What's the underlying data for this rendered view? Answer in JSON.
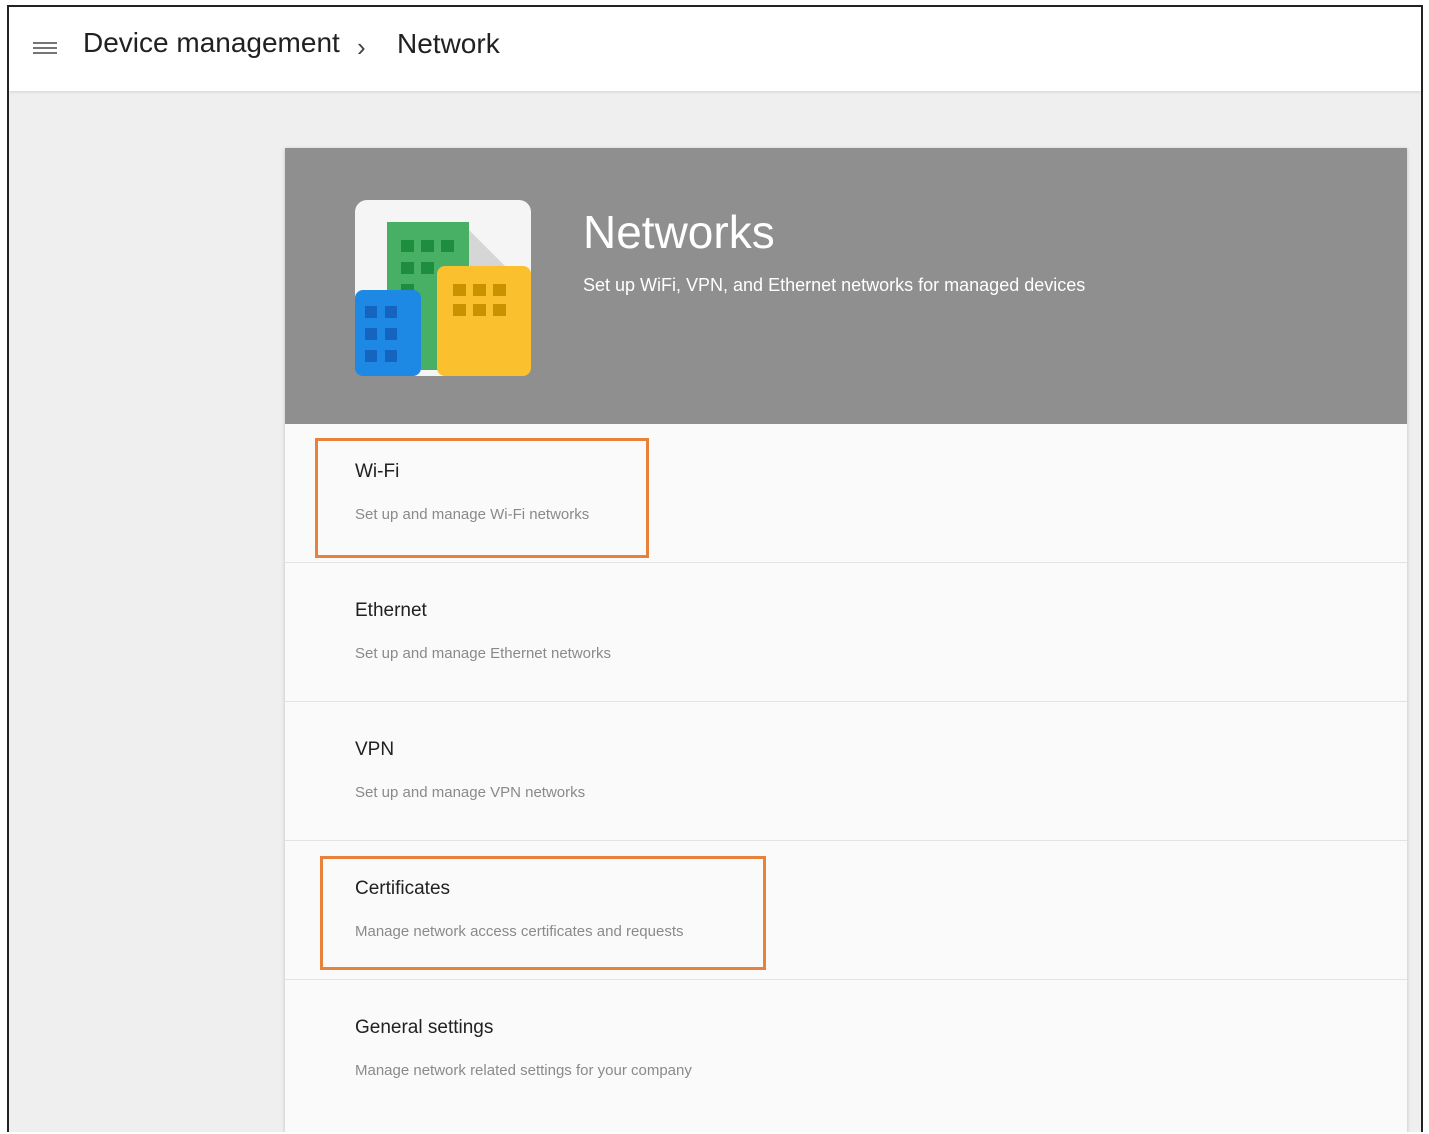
{
  "header": {
    "menu_icon": "hamburger-menu-icon",
    "breadcrumb": {
      "root": "Device management",
      "separator": "›",
      "current": "Network"
    }
  },
  "hero": {
    "icon": "buildings-icon",
    "title": "Networks",
    "subtitle": "Set up WiFi, VPN, and Ethernet networks for managed devices"
  },
  "settings": [
    {
      "title": "Wi-Fi",
      "description": "Set up and manage Wi-Fi networks",
      "highlighted": true
    },
    {
      "title": "Ethernet",
      "description": "Set up and manage Ethernet networks",
      "highlighted": false
    },
    {
      "title": "VPN",
      "description": "Set up and manage VPN networks",
      "highlighted": false
    },
    {
      "title": "Certificates",
      "description": "Manage network access certificates and requests",
      "highlighted": true
    },
    {
      "title": "General settings",
      "description": "Manage network related settings for your company",
      "highlighted": false
    }
  ],
  "colors": {
    "hero_background": "#8f8f8f",
    "highlight_border": "#e8823a",
    "icon_green": "#34a853",
    "icon_blue": "#1e88e5",
    "icon_yellow": "#fbc02d"
  }
}
